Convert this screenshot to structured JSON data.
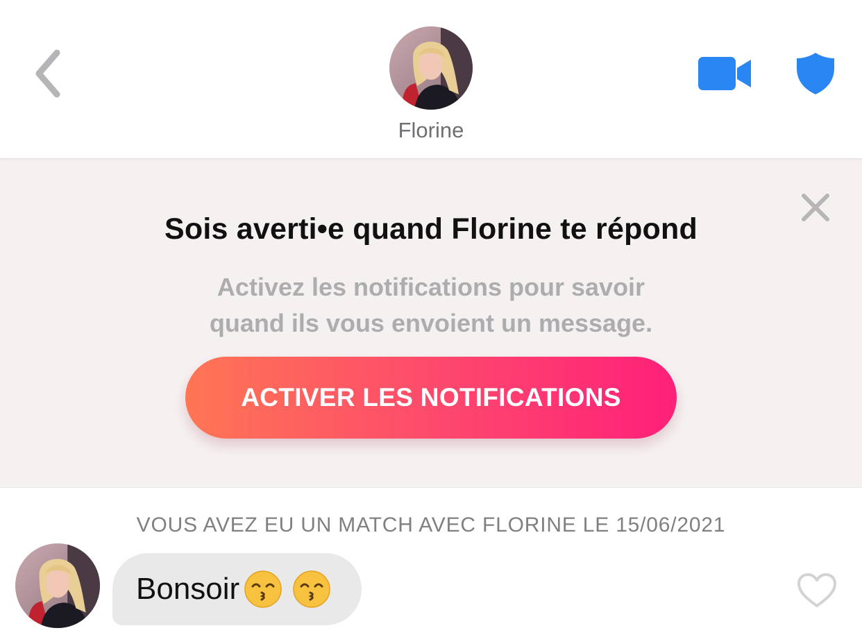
{
  "header": {
    "back_icon": "chevron-left-icon",
    "match_name": "Florine",
    "video_icon": "video-camera-icon",
    "safety_icon": "shield-icon",
    "accent_color": "#2a86f2"
  },
  "banner": {
    "close_icon": "close-icon",
    "title": "Sois averti•e quand Florine te répond",
    "subtitle": "Activez les notifications pour savoir quand ils vous envoient un message.",
    "cta_label": "ACTIVER LES NOTIFICATIONS",
    "cta_gradient": [
      "#ff7654",
      "#fe2079"
    ]
  },
  "conversation": {
    "match_info": "VOUS AVEZ EU UN MATCH AVEC FLORINE LE 15/06/2021",
    "messages": [
      {
        "text": "Bonsoir",
        "emojis": [
          "kissing-face-with-smiling-eyes",
          "kissing-face-with-smiling-eyes"
        ],
        "liked": false,
        "like_icon": "heart-outline-icon"
      }
    ]
  }
}
